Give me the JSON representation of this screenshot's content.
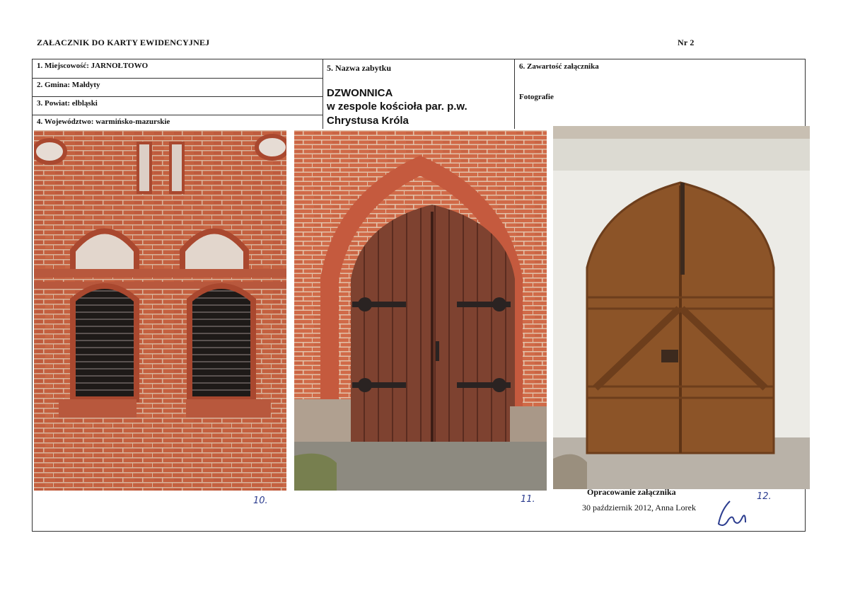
{
  "header": {
    "title": "ZAŁACZNIK DO KARTY EWIDENCYJNEJ",
    "number": "Nr 2"
  },
  "fields": {
    "miejscowosc": "1. Miejscowość: JARNOŁTOWO",
    "gmina": "2. Gmina: Małdyty",
    "powiat": "3. Powiat: elbląski",
    "wojewodztwo": "4. Województwo: warmińsko-mazurskie"
  },
  "monument": {
    "label": "5. Nazwa zabytku",
    "name": "DZWONNICA",
    "subtitle_1": "w zespole kościoła par. p.w.",
    "subtitle_2": "Chrystusa Króla"
  },
  "contents": {
    "label": "6. Zawartość załącznika",
    "value": "Fotografie"
  },
  "photo_numbers": [
    "10.",
    "11.",
    "12."
  ],
  "prepared": {
    "label": "Opracowanie załącznika",
    "date_author": "30 październik 2012, Anna Lorek"
  },
  "colors": {
    "brick": "#c0583a",
    "mortar": "#d9b6a0",
    "door_brown": "#7a3f2c",
    "wood_door": "#8a5227",
    "white_wall": "#ecebe6",
    "handwriting": "#2c3d8f"
  }
}
